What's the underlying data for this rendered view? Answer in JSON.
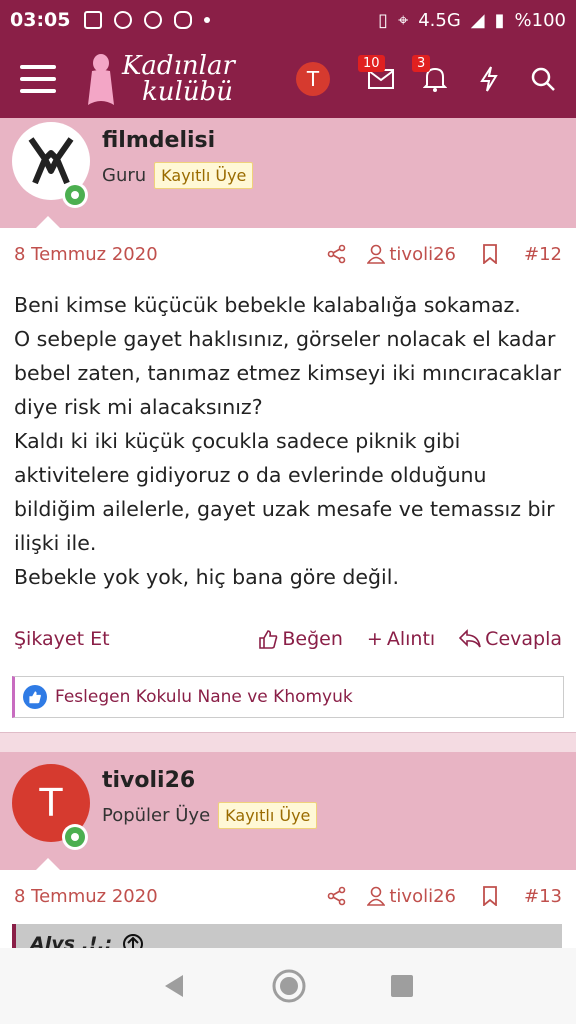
{
  "status_bar": {
    "time": "03:05",
    "network": "4.5G",
    "battery": "%100"
  },
  "app_bar": {
    "logo_line1": "Kadınlar",
    "logo_line2": "kulübü",
    "avatar_letter": "T",
    "messages_badge": "10",
    "alerts_badge": "3"
  },
  "posts": [
    {
      "username": "filmdelisi",
      "rank": "Guru",
      "tag": "Kayıtlı Üye",
      "date": "8 Temmuz 2020",
      "author": "tivoli26",
      "number": "#12",
      "body": "Beni kimse küçücük bebekle kalabalığa sokamaz.\nO sebeple gayet haklısınız, görseler nolacak el kadar bebel zaten, tanımaz etmez kimseyi iki mıncıracaklar diye risk mi alacaksınız?\nKaldı ki iki küçük çocukla sadece piknik gibi aktivitelere gidiyoruz o da evlerinde olduğunu bildiğim ailelerle, gayet uzak mesafe ve temassız bir ilişki ile.\nBebekle yok yok, hiç bana göre değil.",
      "report": "Şikayet Et",
      "like": "Beğen",
      "quote": "Alıntı",
      "reply": "Cevapla",
      "likes_text": "Feslegen Kokulu Nane ve Khomyuk"
    },
    {
      "username": "tivoli26",
      "avatar_letter": "T",
      "rank": "Popüler Üye",
      "tag": "Kayıtlı Üye",
      "date": "8 Temmuz 2020",
      "author": "tivoli26",
      "number": "#13",
      "quote_author": "Alys .!.:"
    }
  ],
  "colors": {
    "brand": "#8a1f47",
    "header_bg": "#e8b4c4",
    "accent_text": "#c0504d"
  }
}
